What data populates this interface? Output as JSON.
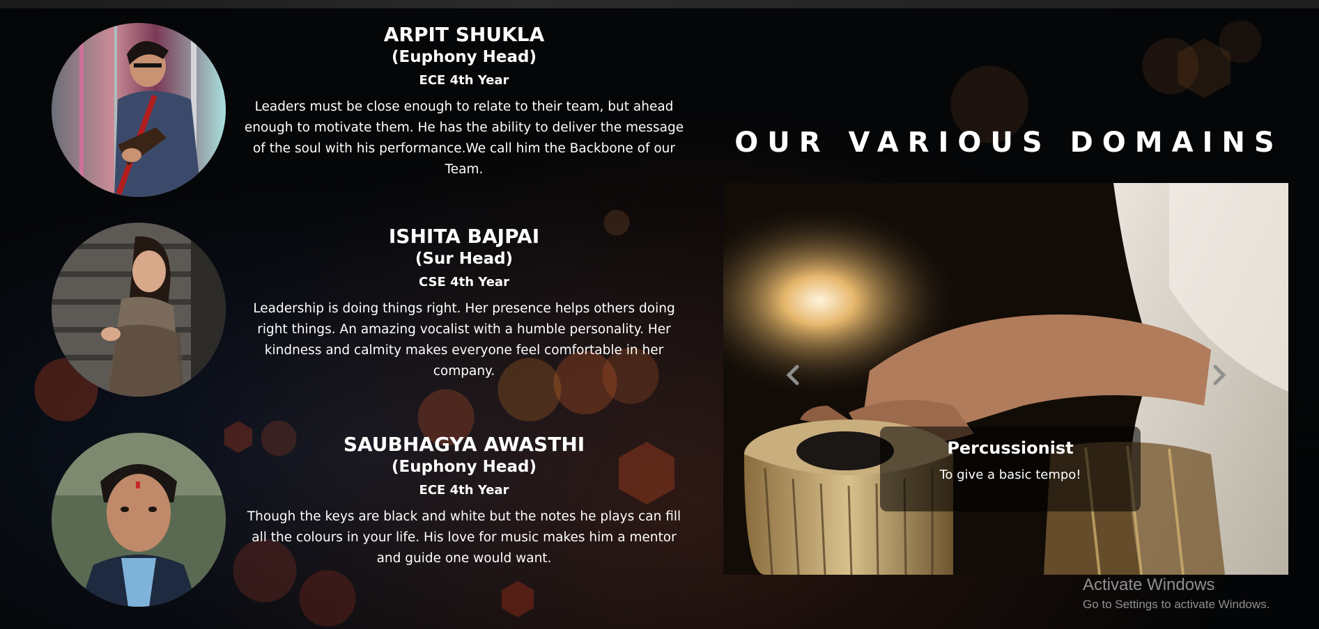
{
  "team": [
    {
      "name": "ARPIT SHUKLA",
      "role": "(Euphony Head)",
      "year": "ECE 4th Year",
      "description": "Leaders must be close enough to relate to their team, but ahead enough to motivate them. He has the ability to deliver the message of the soul with his performance.We call him the Backbone of our Team."
    },
    {
      "name": "ISHITA BAJPAI",
      "role": "(Sur Head)",
      "year": "CSE 4th Year",
      "description": "Leadership is doing things right. Her presence helps others doing right things. An amazing vocalist with a humble personality. Her kindness and calmity makes everyone feel comfortable in her company."
    },
    {
      "name": "SAUBHAGYA AWASTHI",
      "role": "(Euphony Head)",
      "year": "ECE 4th Year",
      "description": "Though the keys are black and white but the notes he plays can fill all the colours in your life. His love for music makes him a mentor and guide one would want."
    }
  ],
  "domains": {
    "title": "OUR VARIOUS DOMAINS",
    "carousel": {
      "active_slide": {
        "title": "Percussionist",
        "caption": "To give a basic tempo!"
      },
      "prev_icon": "chevron-left-icon",
      "next_icon": "chevron-right-icon"
    }
  },
  "os_watermark": {
    "title": "Activate Windows",
    "subtitle": "Go to Settings to activate Windows."
  }
}
